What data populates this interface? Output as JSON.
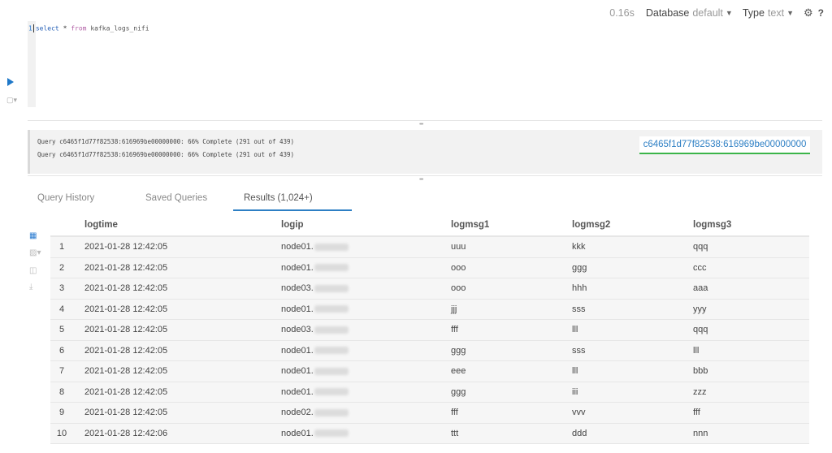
{
  "toolbar": {
    "exec_time": "0.16s",
    "database_label": "Database",
    "database_value": "default",
    "type_label": "Type",
    "type_value": "text",
    "help": "?"
  },
  "editor": {
    "line_number": "1",
    "kw_select": "select",
    "star": "*",
    "kw_from": "from",
    "table": "kafka_logs_nifi"
  },
  "log": {
    "lines": [
      "Query c6465f1d77f82538:616969be00000000: 66% Complete (291 out of 439)",
      "Query c6465f1d77f82538:616969be00000000: 66% Complete (291 out of 439)"
    ],
    "query_id": "c6465f1d77f82538:616969be00000000"
  },
  "tabs": [
    {
      "label": "Query History"
    },
    {
      "label": "Saved Queries"
    },
    {
      "label": "Results (1,024+)"
    }
  ],
  "table": {
    "columns": [
      "logtime",
      "logip",
      "logmsg1",
      "logmsg2",
      "logmsg3"
    ],
    "rows": [
      {
        "n": "1",
        "logtime": "2021-01-28 12:42:05",
        "logip": "node01.",
        "logmsg1": "uuu",
        "logmsg2": "kkk",
        "logmsg3": "qqq"
      },
      {
        "n": "2",
        "logtime": "2021-01-28 12:42:05",
        "logip": "node01.",
        "logmsg1": "ooo",
        "logmsg2": "ggg",
        "logmsg3": "ccc"
      },
      {
        "n": "3",
        "logtime": "2021-01-28 12:42:05",
        "logip": "node03.",
        "logmsg1": "ooo",
        "logmsg2": "hhh",
        "logmsg3": "aaa"
      },
      {
        "n": "4",
        "logtime": "2021-01-28 12:42:05",
        "logip": "node01.",
        "logmsg1": "jjj",
        "logmsg2": "sss",
        "logmsg3": "yyy"
      },
      {
        "n": "5",
        "logtime": "2021-01-28 12:42:05",
        "logip": "node03.",
        "logmsg1": "fff",
        "logmsg2": "lll",
        "logmsg3": "qqq"
      },
      {
        "n": "6",
        "logtime": "2021-01-28 12:42:05",
        "logip": "node01.",
        "logmsg1": "ggg",
        "logmsg2": "sss",
        "logmsg3": "lll"
      },
      {
        "n": "7",
        "logtime": "2021-01-28 12:42:05",
        "logip": "node01.",
        "logmsg1": "eee",
        "logmsg2": "lll",
        "logmsg3": "bbb"
      },
      {
        "n": "8",
        "logtime": "2021-01-28 12:42:05",
        "logip": "node01.",
        "logmsg1": "ggg",
        "logmsg2": "iii",
        "logmsg3": "zzz"
      },
      {
        "n": "9",
        "logtime": "2021-01-28 12:42:05",
        "logip": "node02.",
        "logmsg1": "fff",
        "logmsg2": "vvv",
        "logmsg3": "fff"
      },
      {
        "n": "10",
        "logtime": "2021-01-28 12:42:06",
        "logip": "node01.",
        "logmsg1": "ttt",
        "logmsg2": "ddd",
        "logmsg3": "nnn"
      }
    ]
  },
  "colors": {
    "accent": "#2d7fc4",
    "run": "#1f78c8",
    "badge_underline": "#3bb54a"
  }
}
